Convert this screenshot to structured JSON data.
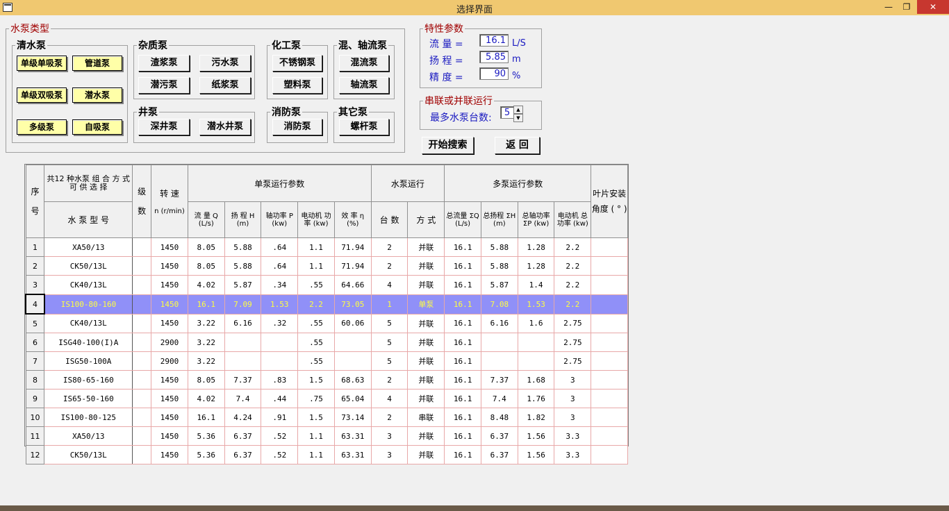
{
  "window": {
    "title": "选择界面"
  },
  "pump_types": {
    "legend": "水泵类型",
    "clear_water": {
      "legend": "清水泵",
      "buttons": [
        "单级单吸泵",
        "管道泵",
        "单级双吸泵",
        "潜水泵",
        "多级泵",
        "自吸泵"
      ]
    },
    "impurity": {
      "legend": "杂质泵",
      "buttons": [
        "渣浆泵",
        "污水泵",
        "潜污泵",
        "纸浆泵"
      ]
    },
    "chemical": {
      "legend": "化工泵",
      "buttons": [
        "不锈钢泵",
        "塑料泵"
      ]
    },
    "mixed_axial": {
      "legend": "混、轴流泵",
      "buttons": [
        "混流泵",
        "轴流泵"
      ]
    },
    "well": {
      "legend": "井泵",
      "buttons": [
        "深井泵",
        "潜水井泵"
      ]
    },
    "fire": {
      "legend": "消防泵",
      "buttons": [
        "消防泵"
      ]
    },
    "other": {
      "legend": "其它泵",
      "buttons": [
        "螺杆泵"
      ]
    }
  },
  "params": {
    "legend": "特性参数",
    "flow": {
      "label": "流  量 =",
      "value": "16.1",
      "unit": "L/S"
    },
    "head": {
      "label": "扬  程 =",
      "value": "5.85",
      "unit": "m"
    },
    "precision": {
      "label": "精  度 =",
      "value": "90",
      "unit": "%"
    }
  },
  "series_parallel": {
    "legend": "串联或并联运行",
    "label": "最多水泵台数:",
    "value": "5"
  },
  "actions": {
    "search": "开始搜索",
    "back": "返  回"
  },
  "table": {
    "headers": {
      "seq": "序号",
      "combo": "共12 种水泵 组 合 方 式 可 供 选 择",
      "model": "水 泵 型 号",
      "stage": "级数",
      "speed": "转 速",
      "speed_unit": "n (r/min)",
      "single_group": "单泵运行参数",
      "run_group": "水泵运行",
      "multi_group": "多泵运行参数",
      "blade": "叶片安装角度 ( ° )",
      "flow": "流 量 Q (L/s)",
      "head": "扬 程 H (m)",
      "shaft": "轴功率 P (kw)",
      "motor": "电动机 功率 (kw)",
      "eff": "效 率 η (%)",
      "count": "台 数",
      "mode": "方 式",
      "total_flow": "总流量 ΣQ (L/s)",
      "total_head": "总扬程 ΣH (m)",
      "total_shaft": "总轴功率 ΣP (kw)",
      "total_motor": "电动机 总功率 (kw)"
    },
    "selected_row": 4,
    "rows": [
      [
        "1",
        "XA50/13",
        "",
        "1450",
        "8.05",
        "5.88",
        ".64",
        "1.1",
        "71.94",
        "2",
        "并联",
        "16.1",
        "5.88",
        "1.28",
        "2.2",
        ""
      ],
      [
        "2",
        "CK50/13L",
        "",
        "1450",
        "8.05",
        "5.88",
        ".64",
        "1.1",
        "71.94",
        "2",
        "并联",
        "16.1",
        "5.88",
        "1.28",
        "2.2",
        ""
      ],
      [
        "3",
        "CK40/13L",
        "",
        "1450",
        "4.02",
        "5.87",
        ".34",
        ".55",
        "64.66",
        "4",
        "并联",
        "16.1",
        "5.87",
        "1.4",
        "2.2",
        ""
      ],
      [
        "4",
        "IS100-80-160",
        "",
        "1450",
        "16.1",
        "7.09",
        "1.53",
        "2.2",
        "73.05",
        "1",
        "单泵",
        "16.1",
        "7.08",
        "1.53",
        "2.2",
        ""
      ],
      [
        "5",
        "CK40/13L",
        "",
        "1450",
        "3.22",
        "6.16",
        ".32",
        ".55",
        "60.06",
        "5",
        "并联",
        "16.1",
        "6.16",
        "1.6",
        "2.75",
        ""
      ],
      [
        "6",
        "ISG40-100(I)A",
        "",
        "2900",
        "3.22",
        "",
        "",
        ".55",
        "",
        "5",
        "并联",
        "16.1",
        "",
        "",
        "2.75",
        ""
      ],
      [
        "7",
        "ISG50-100A",
        "",
        "2900",
        "3.22",
        "",
        "",
        ".55",
        "",
        "5",
        "并联",
        "16.1",
        "",
        "",
        "2.75",
        ""
      ],
      [
        "8",
        "IS80-65-160",
        "",
        "1450",
        "8.05",
        "7.37",
        ".83",
        "1.5",
        "68.63",
        "2",
        "并联",
        "16.1",
        "7.37",
        "1.68",
        "3",
        ""
      ],
      [
        "9",
        "IS65-50-160",
        "",
        "1450",
        "4.02",
        "7.4",
        ".44",
        ".75",
        "65.04",
        "4",
        "并联",
        "16.1",
        "7.4",
        "1.76",
        "3",
        ""
      ],
      [
        "10",
        "IS100-80-125",
        "",
        "1450",
        "16.1",
        "4.24",
        ".91",
        "1.5",
        "73.14",
        "2",
        "串联",
        "16.1",
        "8.48",
        "1.82",
        "3",
        ""
      ],
      [
        "11",
        "XA50/13",
        "",
        "1450",
        "5.36",
        "6.37",
        ".52",
        "1.1",
        "63.31",
        "3",
        "并联",
        "16.1",
        "6.37",
        "1.56",
        "3.3",
        ""
      ],
      [
        "12",
        "CK50/13L",
        "",
        "1450",
        "5.36",
        "6.37",
        ".52",
        "1.1",
        "63.31",
        "3",
        "并联",
        "16.1",
        "6.37",
        "1.56",
        "3.3",
        ""
      ]
    ]
  }
}
